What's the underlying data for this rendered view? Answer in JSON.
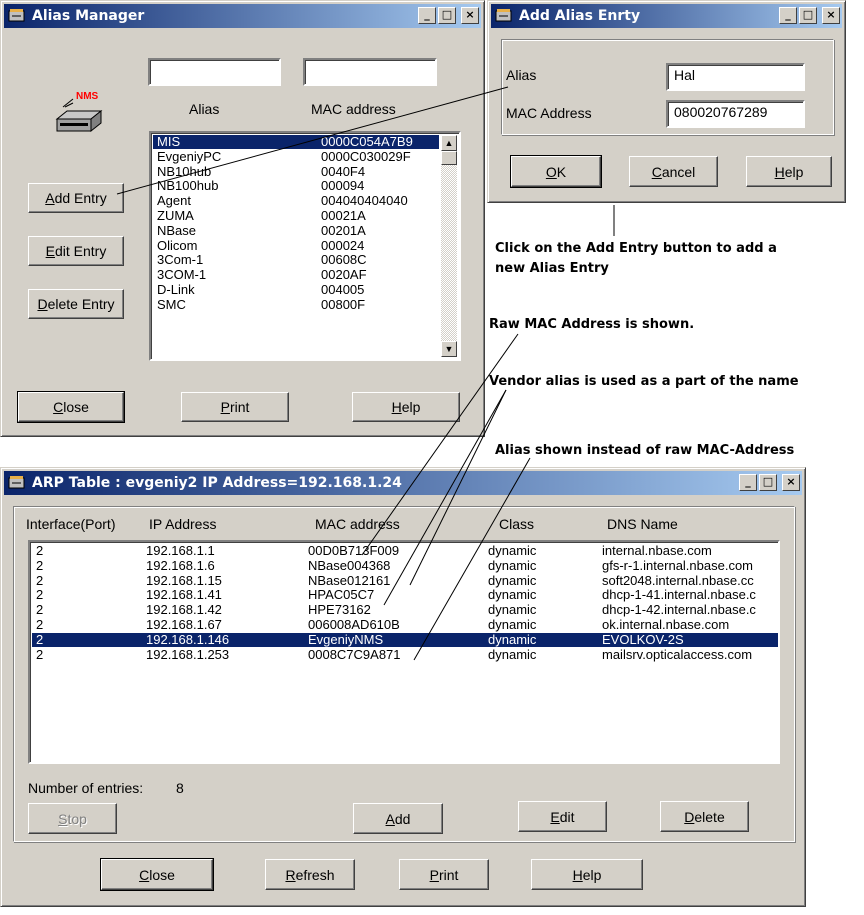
{
  "alias_manager": {
    "title": "Alias Manager",
    "input_alias_value": "",
    "input_mac_value": "",
    "col_alias": "Alias",
    "col_mac": "MAC address",
    "items": [
      {
        "alias": "MIS",
        "mac": "0000C054A7B9",
        "selected": true
      },
      {
        "alias": "EvgeniyPC",
        "mac": "0000C030029F"
      },
      {
        "alias": "NB10hub",
        "mac": "0040F4"
      },
      {
        "alias": "NB100hub",
        "mac": "000094"
      },
      {
        "alias": "Agent",
        "mac": "004040404040"
      },
      {
        "alias": "ZUMA",
        "mac": "00021A"
      },
      {
        "alias": "NBase",
        "mac": "00201A"
      },
      {
        "alias": "Olicom",
        "mac": "000024"
      },
      {
        "alias": "3Com-1",
        "mac": "00608C"
      },
      {
        "alias": "3COM-1",
        "mac": "0020AF"
      },
      {
        "alias": "D-Link",
        "mac": "004005"
      },
      {
        "alias": "SMC",
        "mac": "00800F"
      }
    ],
    "add_entry": {
      "pre": "",
      "u": "A",
      "post": "dd Entry"
    },
    "edit_entry": {
      "pre": "",
      "u": "E",
      "post": "dit Entry"
    },
    "delete_entry": {
      "pre": "",
      "u": "D",
      "post": "elete Entry"
    },
    "close": {
      "pre": "",
      "u": "C",
      "post": "lose"
    },
    "print": {
      "pre": "",
      "u": "P",
      "post": "rint"
    },
    "help": {
      "pre": "",
      "u": "H",
      "post": "elp"
    },
    "icon_text": "NMS"
  },
  "add_alias": {
    "title": "Add Alias Enrty",
    "alias_label": "Alias",
    "alias_value": "Hal",
    "mac_label": "MAC Address",
    "mac_value": "080020767289",
    "ok": {
      "pre": "",
      "u": "O",
      "post": "K"
    },
    "cancel": {
      "pre": "",
      "u": "C",
      "post": "ancel"
    },
    "help": {
      "pre": "",
      "u": "H",
      "post": "elp"
    }
  },
  "annotations": {
    "add_entry_line1": "Click on the Add Entry button to add a",
    "add_entry_line2": "new Alias Entry",
    "raw_mac": "Raw MAC Address is shown.",
    "vendor_alias": "Vendor alias is used as a part of the name",
    "alias_instead": "Alias shown instead of raw MAC-Address"
  },
  "arp_table": {
    "title": "ARP Table : evgeniy2 IP Address=192.168.1.24",
    "columns": [
      "Interface(Port)",
      "IP Address",
      "MAC address",
      "Class",
      "DNS Name"
    ],
    "rows": [
      {
        "port": "2",
        "ip": "192.168.1.1",
        "mac": "00D0B713F009",
        "cls": "dynamic",
        "dns": "internal.nbase.com"
      },
      {
        "port": "2",
        "ip": "192.168.1.6",
        "mac": "NBase004368",
        "cls": "dynamic",
        "dns": "gfs-r-1.internal.nbase.com"
      },
      {
        "port": "2",
        "ip": "192.168.1.15",
        "mac": "NBase012161",
        "cls": "dynamic",
        "dns": "soft2048.internal.nbase.cc"
      },
      {
        "port": "2",
        "ip": "192.168.1.41",
        "mac": "HPAC05C7",
        "cls": "dynamic",
        "dns": "dhcp-1-41.internal.nbase.c"
      },
      {
        "port": "2",
        "ip": "192.168.1.42",
        "mac": "HPE73162",
        "cls": "dynamic",
        "dns": "dhcp-1-42.internal.nbase.c"
      },
      {
        "port": "2",
        "ip": "192.168.1.67",
        "mac": "006008AD610B",
        "cls": "dynamic",
        "dns": "ok.internal.nbase.com"
      },
      {
        "port": "2",
        "ip": "192.168.1.146",
        "mac": "EvgeniyNMS",
        "cls": "dynamic",
        "dns": "EVOLKOV-2S",
        "selected": true
      },
      {
        "port": "2",
        "ip": "192.168.1.253",
        "mac": "0008C7C9A871",
        "cls": "dynamic",
        "dns": "mailsrv.opticalaccess.com"
      }
    ],
    "entries_label": "Number of entries:",
    "entries_count": "8",
    "stop": {
      "pre": "",
      "u": "S",
      "post": "top"
    },
    "add": {
      "pre": "",
      "u": "A",
      "post": "dd"
    },
    "edit": {
      "pre": "",
      "u": "E",
      "post": "dit"
    },
    "delete": {
      "pre": "",
      "u": "D",
      "post": "elete"
    },
    "close": {
      "pre": "",
      "u": "C",
      "post": "lose"
    },
    "refresh": {
      "pre": "",
      "u": "R",
      "post": "efresh"
    },
    "print": {
      "pre": "",
      "u": "P",
      "post": "rint"
    },
    "help": {
      "pre": "",
      "u": "H",
      "post": "elp"
    }
  },
  "window_controls": {
    "minimize": "_",
    "maximize": "□",
    "close": "×"
  },
  "colors": {
    "title_active": "#0a246a",
    "selection": "#0a246a",
    "face": "#d4d0c8"
  }
}
